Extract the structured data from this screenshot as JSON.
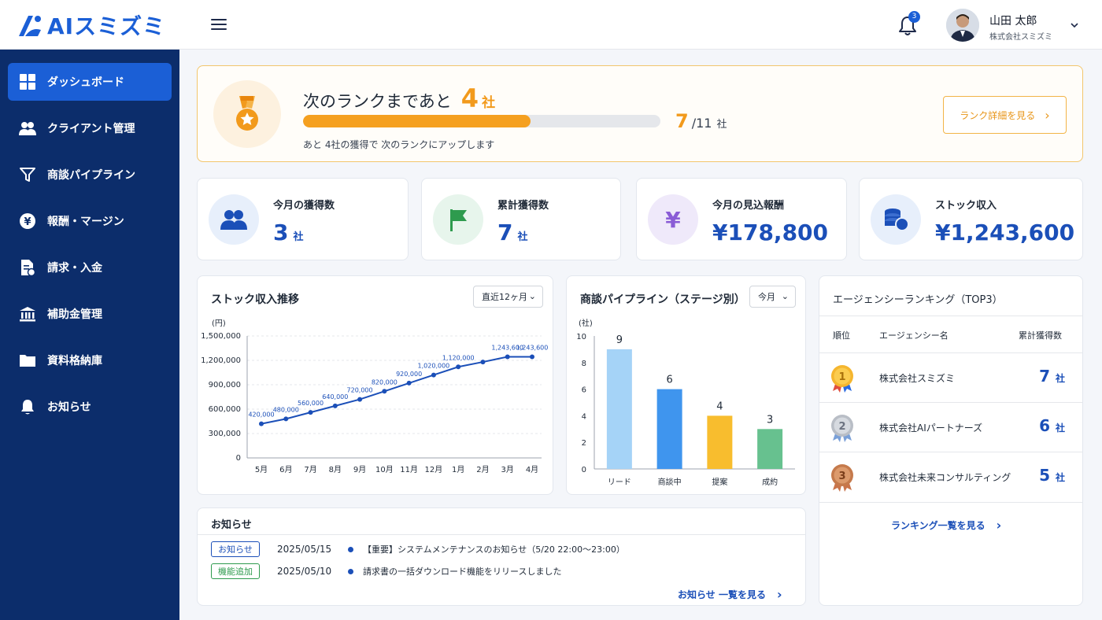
{
  "header": {
    "logo_text": "AIスミズミ",
    "notification_count": "3",
    "user_name": "山田 太郎",
    "user_company": "株式会社スミズミ"
  },
  "sidebar": {
    "items": [
      {
        "label": "ダッシュボード",
        "icon": "grid-icon",
        "active": true
      },
      {
        "label": "クライアント管理",
        "icon": "users-icon"
      },
      {
        "label": "商談パイプライン",
        "icon": "funnel-icon"
      },
      {
        "label": "報酬・マージン",
        "icon": "yen-icon"
      },
      {
        "label": "請求・入金",
        "icon": "invoice-icon"
      },
      {
        "label": "補助金管理",
        "icon": "bank-icon"
      },
      {
        "label": "資料格納庫",
        "icon": "folder-icon"
      },
      {
        "label": "お知らせ",
        "icon": "bell-icon"
      }
    ]
  },
  "rank": {
    "title_prefix": "次のランクまであと",
    "remaining": "4",
    "remaining_unit": "社",
    "progress_fraction": 0.636,
    "current": "7",
    "total": "/11",
    "unit": "社",
    "subtext": "あと 4社の獲得で 次のランクにアップします",
    "button_label": "ランク詳細を見る"
  },
  "kpis": [
    {
      "label": "今月の獲得数",
      "value": "3",
      "unit": "社",
      "icon": "users-icon"
    },
    {
      "label": "累計獲得数",
      "value": "7",
      "unit": "社",
      "icon": "flag-icon"
    },
    {
      "label": "今月の見込報酬",
      "value": "¥178,800",
      "unit": "",
      "icon": "yen-icon"
    },
    {
      "label": "ストック収入",
      "value": "¥1,243,600",
      "unit": "",
      "icon": "coins-icon"
    }
  ],
  "stock_chart": {
    "title": "ストック収入推移",
    "period_select": "直近12ヶ月"
  },
  "pipeline_chart": {
    "title": "商談パイプライン（ステージ別）",
    "period_select": "今月"
  },
  "chart_data": [
    {
      "type": "line",
      "title": "ストック収入推移",
      "ylabel": "(円)",
      "ylim": [
        0,
        1500000
      ],
      "yticks": [
        "1,500,000",
        "1,200,000",
        "900,000",
        "600,000",
        "300,000",
        "0"
      ],
      "categories": [
        "5月",
        "6月",
        "7月",
        "8月",
        "9月",
        "10月",
        "11月",
        "12月",
        "1月",
        "2月",
        "3月",
        "4月"
      ],
      "values": [
        420000,
        480000,
        560000,
        640000,
        720000,
        820000,
        920000,
        1020000,
        1120000,
        1180000,
        1243600,
        1243600
      ],
      "labels": [
        "420,000",
        "480,000",
        "560,000",
        "640,000",
        "720,000",
        "820,000",
        "920,000",
        "1,020,000",
        "1,120,000",
        "",
        "1,243,600",
        "1,243,600"
      ],
      "color": "#1b4fb8",
      "grid": true
    },
    {
      "type": "bar",
      "title": "商談パイプライン（ステージ別）",
      "ylabel": "(社)",
      "ylim": [
        0,
        10
      ],
      "yticks": [
        "10",
        "8",
        "6",
        "4",
        "2",
        "0"
      ],
      "categories": [
        "リード",
        "商談中",
        "提案",
        "成約"
      ],
      "values": [
        9,
        6,
        4,
        3
      ],
      "colors": [
        "#a5d3f7",
        "#3f95ee",
        "#f8bd2e",
        "#67c18f"
      ]
    }
  ],
  "ranking": {
    "title": "エージェンシーランキング（TOP3）",
    "columns": [
      "順位",
      "エージェンシー名",
      "累計獲得数"
    ],
    "rows": [
      {
        "rank": "1",
        "name": "株式会社スミズミ",
        "value": "7",
        "unit": "社",
        "medal": "gold-medal-icon"
      },
      {
        "rank": "2",
        "name": "株式会社AIパートナーズ",
        "value": "6",
        "unit": "社",
        "medal": "silver-medal-icon"
      },
      {
        "rank": "3",
        "name": "株式会社未来コンサルティング",
        "value": "5",
        "unit": "社",
        "medal": "bronze-medal-icon"
      }
    ],
    "link_label": "ランキング一覧を見る"
  },
  "news": {
    "title": "お知らせ",
    "items": [
      {
        "tag": "お知らせ",
        "tag_color": "#1b4fb8",
        "date": "2025/05/15",
        "text": "【重要】システムメンテナンスのお知らせ（5/20 22:00〜23:00）"
      },
      {
        "tag": "機能追加",
        "tag_color": "#2e9b4e",
        "date": "2025/05/10",
        "text": "請求書の一括ダウンロード機能をリリースしました"
      }
    ],
    "link_label": "お知らせ 一覧を見る"
  }
}
